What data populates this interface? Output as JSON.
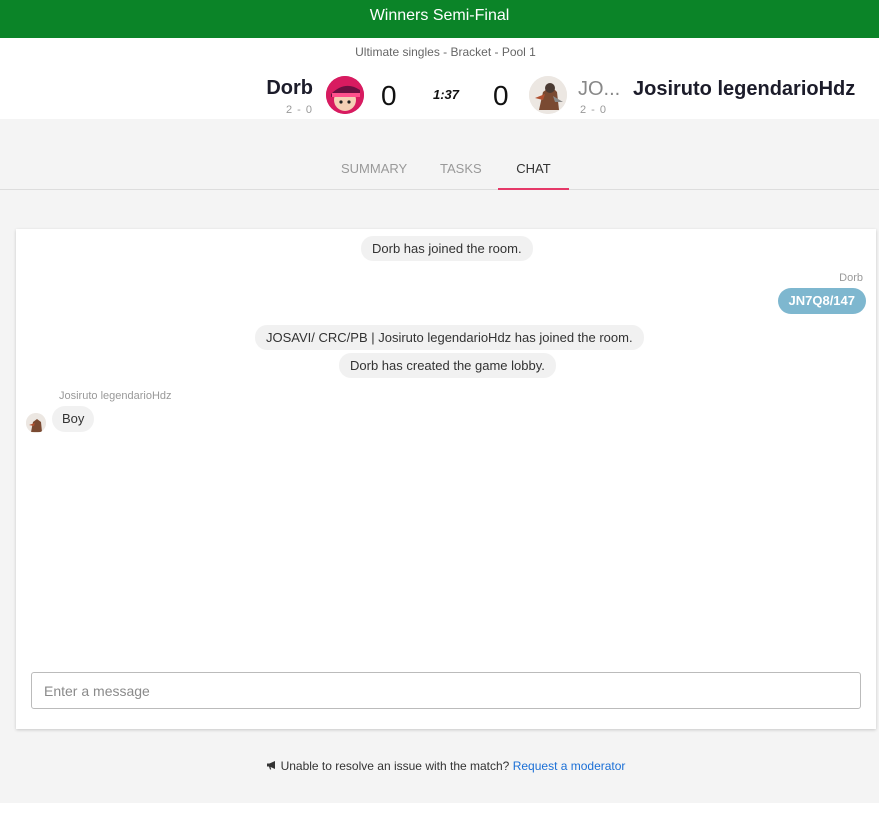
{
  "topbar": {
    "title": "Winners Semi-Final"
  },
  "match": {
    "bracket": "Ultimate singles - Bracket - Pool 1",
    "timer": "1:37",
    "player1": {
      "name": "Dorb",
      "record": "2 - 0",
      "score": "0"
    },
    "player2": {
      "tag_short": "JO...",
      "name": "Josiruto legendarioHdz",
      "record": "2 - 0",
      "score": "0"
    }
  },
  "tabs": [
    {
      "label": "SUMMARY"
    },
    {
      "label": "TASKS"
    },
    {
      "label": "CHAT",
      "active": true
    }
  ],
  "chat": {
    "messages": {
      "sys1": "Dorb has joined the room.",
      "own_sender": "Dorb",
      "own_text": "JN7Q8/147",
      "sys2": "JOSAVI/ CRC/PB | Josiruto legendarioHdz has joined the room.",
      "sys3": "Dorb has created the game lobby.",
      "other_sender": "Josiruto legendarioHdz",
      "other_text": "Boy"
    },
    "input_placeholder": "Enter a message"
  },
  "footer": {
    "icon": "megaphone-icon",
    "text": "Unable to resolve an issue with the match?",
    "link": "Request a moderator"
  },
  "colors": {
    "topbar": "#0b8428",
    "tab_active_underline": "#e53968",
    "own_bubble": "#7eb7cf",
    "link": "#1a6fd6"
  }
}
